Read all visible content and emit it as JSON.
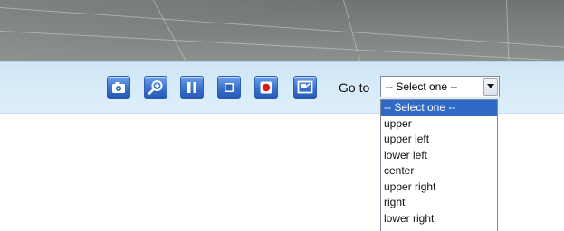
{
  "camera": {
    "description": ""
  },
  "toolbar": {
    "buttons": [
      {
        "name": "snapshot-button",
        "icon": "camera-icon"
      },
      {
        "name": "digital-zoom-button",
        "icon": "zoom-in-icon"
      },
      {
        "name": "pause-button",
        "icon": "pause-icon"
      },
      {
        "name": "stop-button",
        "icon": "stop-icon"
      },
      {
        "name": "record-button",
        "icon": "record-icon"
      },
      {
        "name": "fullscreen-button",
        "icon": "fullscreen-icon"
      }
    ],
    "goto": {
      "label": "Go to",
      "selected": "-- Select one --",
      "options": [
        "-- Select one --",
        "upper",
        "upper left",
        "lower left",
        "center",
        "upper right",
        "right",
        "lower right"
      ],
      "highlighted_index": 0
    }
  },
  "colors": {
    "toolbar_bg": "#d6eaf8",
    "button_blue": "#3c74cf",
    "record_red": "#e01818",
    "highlight": "#3169c6"
  }
}
